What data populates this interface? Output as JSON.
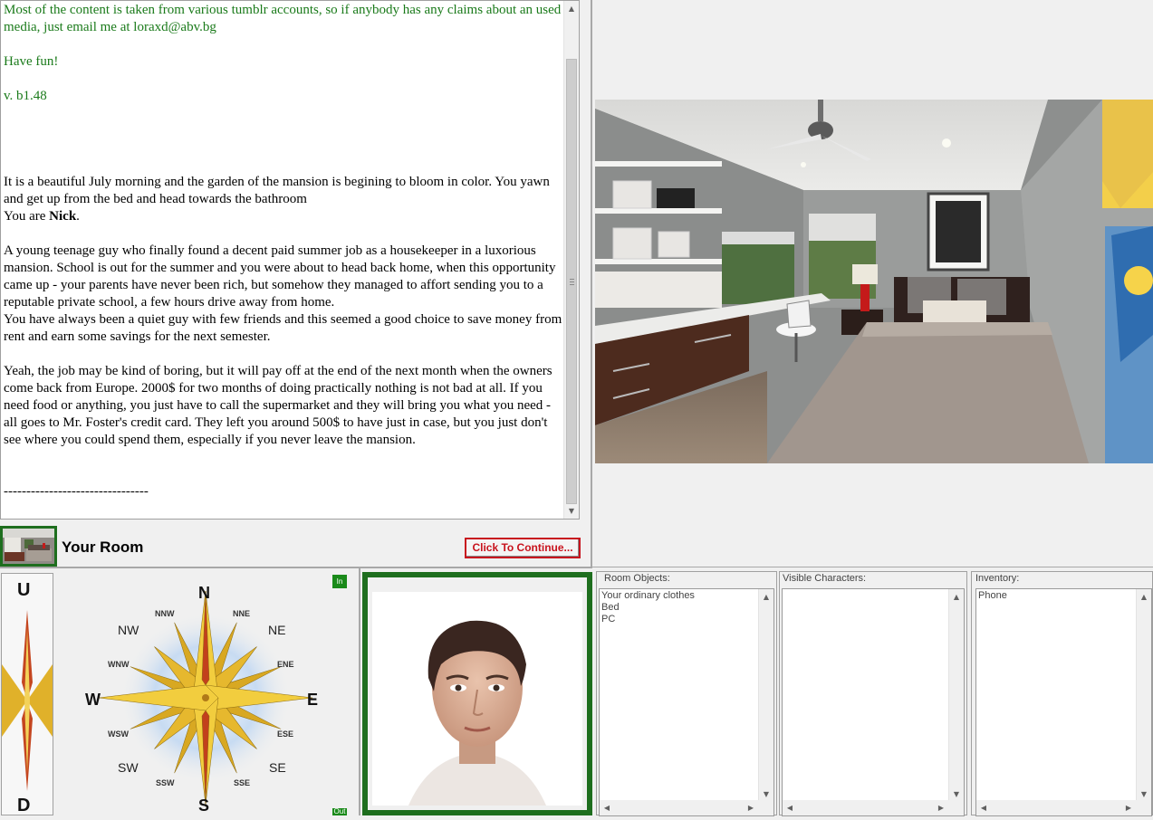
{
  "story": {
    "intro_lines": [
      "Most of the content is taken from various tumblr accounts, so if anybody has any claims about an used media, just email me at loraxd@abv.bg",
      "Have fun!",
      "v. b1.48"
    ],
    "p1": "It is a beautiful July morning and the garden of the mansion is begining to bloom in color. You yawn and get up from the bed and head towards the bathroom",
    "you_are_prefix": "You are ",
    "you_are_name": "Nick",
    "you_are_suffix": ".",
    "p2": "A young teenage guy who finally found a decent paid summer job as a housekeeper in a luxorious mansion. School is out for the summer and you were about to head back home, when this opportunity came up - your parents have never been rich, but somehow they managed to affort sending you to a reputable private school, a few hours drive away from home.",
    "p3": "You have always been a quiet guy with few friends and this seemed a good choice to save money from rent and earn some savings for the next semester.",
    "p4": "Yeah, the job may be kind of boring, but it will pay off at the end of the next month when the owners come back from Europe. 2000$ for two months of doing practically nothing is not bad at all. If you need food or anything, you just have to call the supermarket and they will bring you what you need - all goes to Mr. Foster's credit card. They left you around 500$ to have just in case, but you just don't see where you could spend them, especially if you never leave the mansion.",
    "separator": "--------------------------------"
  },
  "location": {
    "name": "Your Room",
    "continue_label": "Click To Continue..."
  },
  "compass": {
    "up": "U",
    "down": "D",
    "in_label": "In",
    "out_label": "Out",
    "N": "N",
    "S": "S",
    "E": "E",
    "W": "W",
    "NE": "NE",
    "NW": "NW",
    "SE": "SE",
    "SW": "SW",
    "NNE": "NNE",
    "NNW": "NNW",
    "ENE": "ENE",
    "ESE": "ESE",
    "SSE": "SSE",
    "SSW": "SSW",
    "WNW": "WNW",
    "WSW": "WSW"
  },
  "panels": {
    "room_objects": {
      "title": "Room Objects:",
      "items": [
        "Your ordinary clothes",
        "Bed",
        "PC"
      ]
    },
    "visible_characters": {
      "title": "Visible Characters:",
      "items": []
    },
    "inventory": {
      "title": "Inventory:",
      "items": [
        "Phone"
      ]
    }
  },
  "colors": {
    "accent_green": "#1e6e1e",
    "intro_text": "#1a7a1a",
    "continue_red": "#c8141e"
  }
}
